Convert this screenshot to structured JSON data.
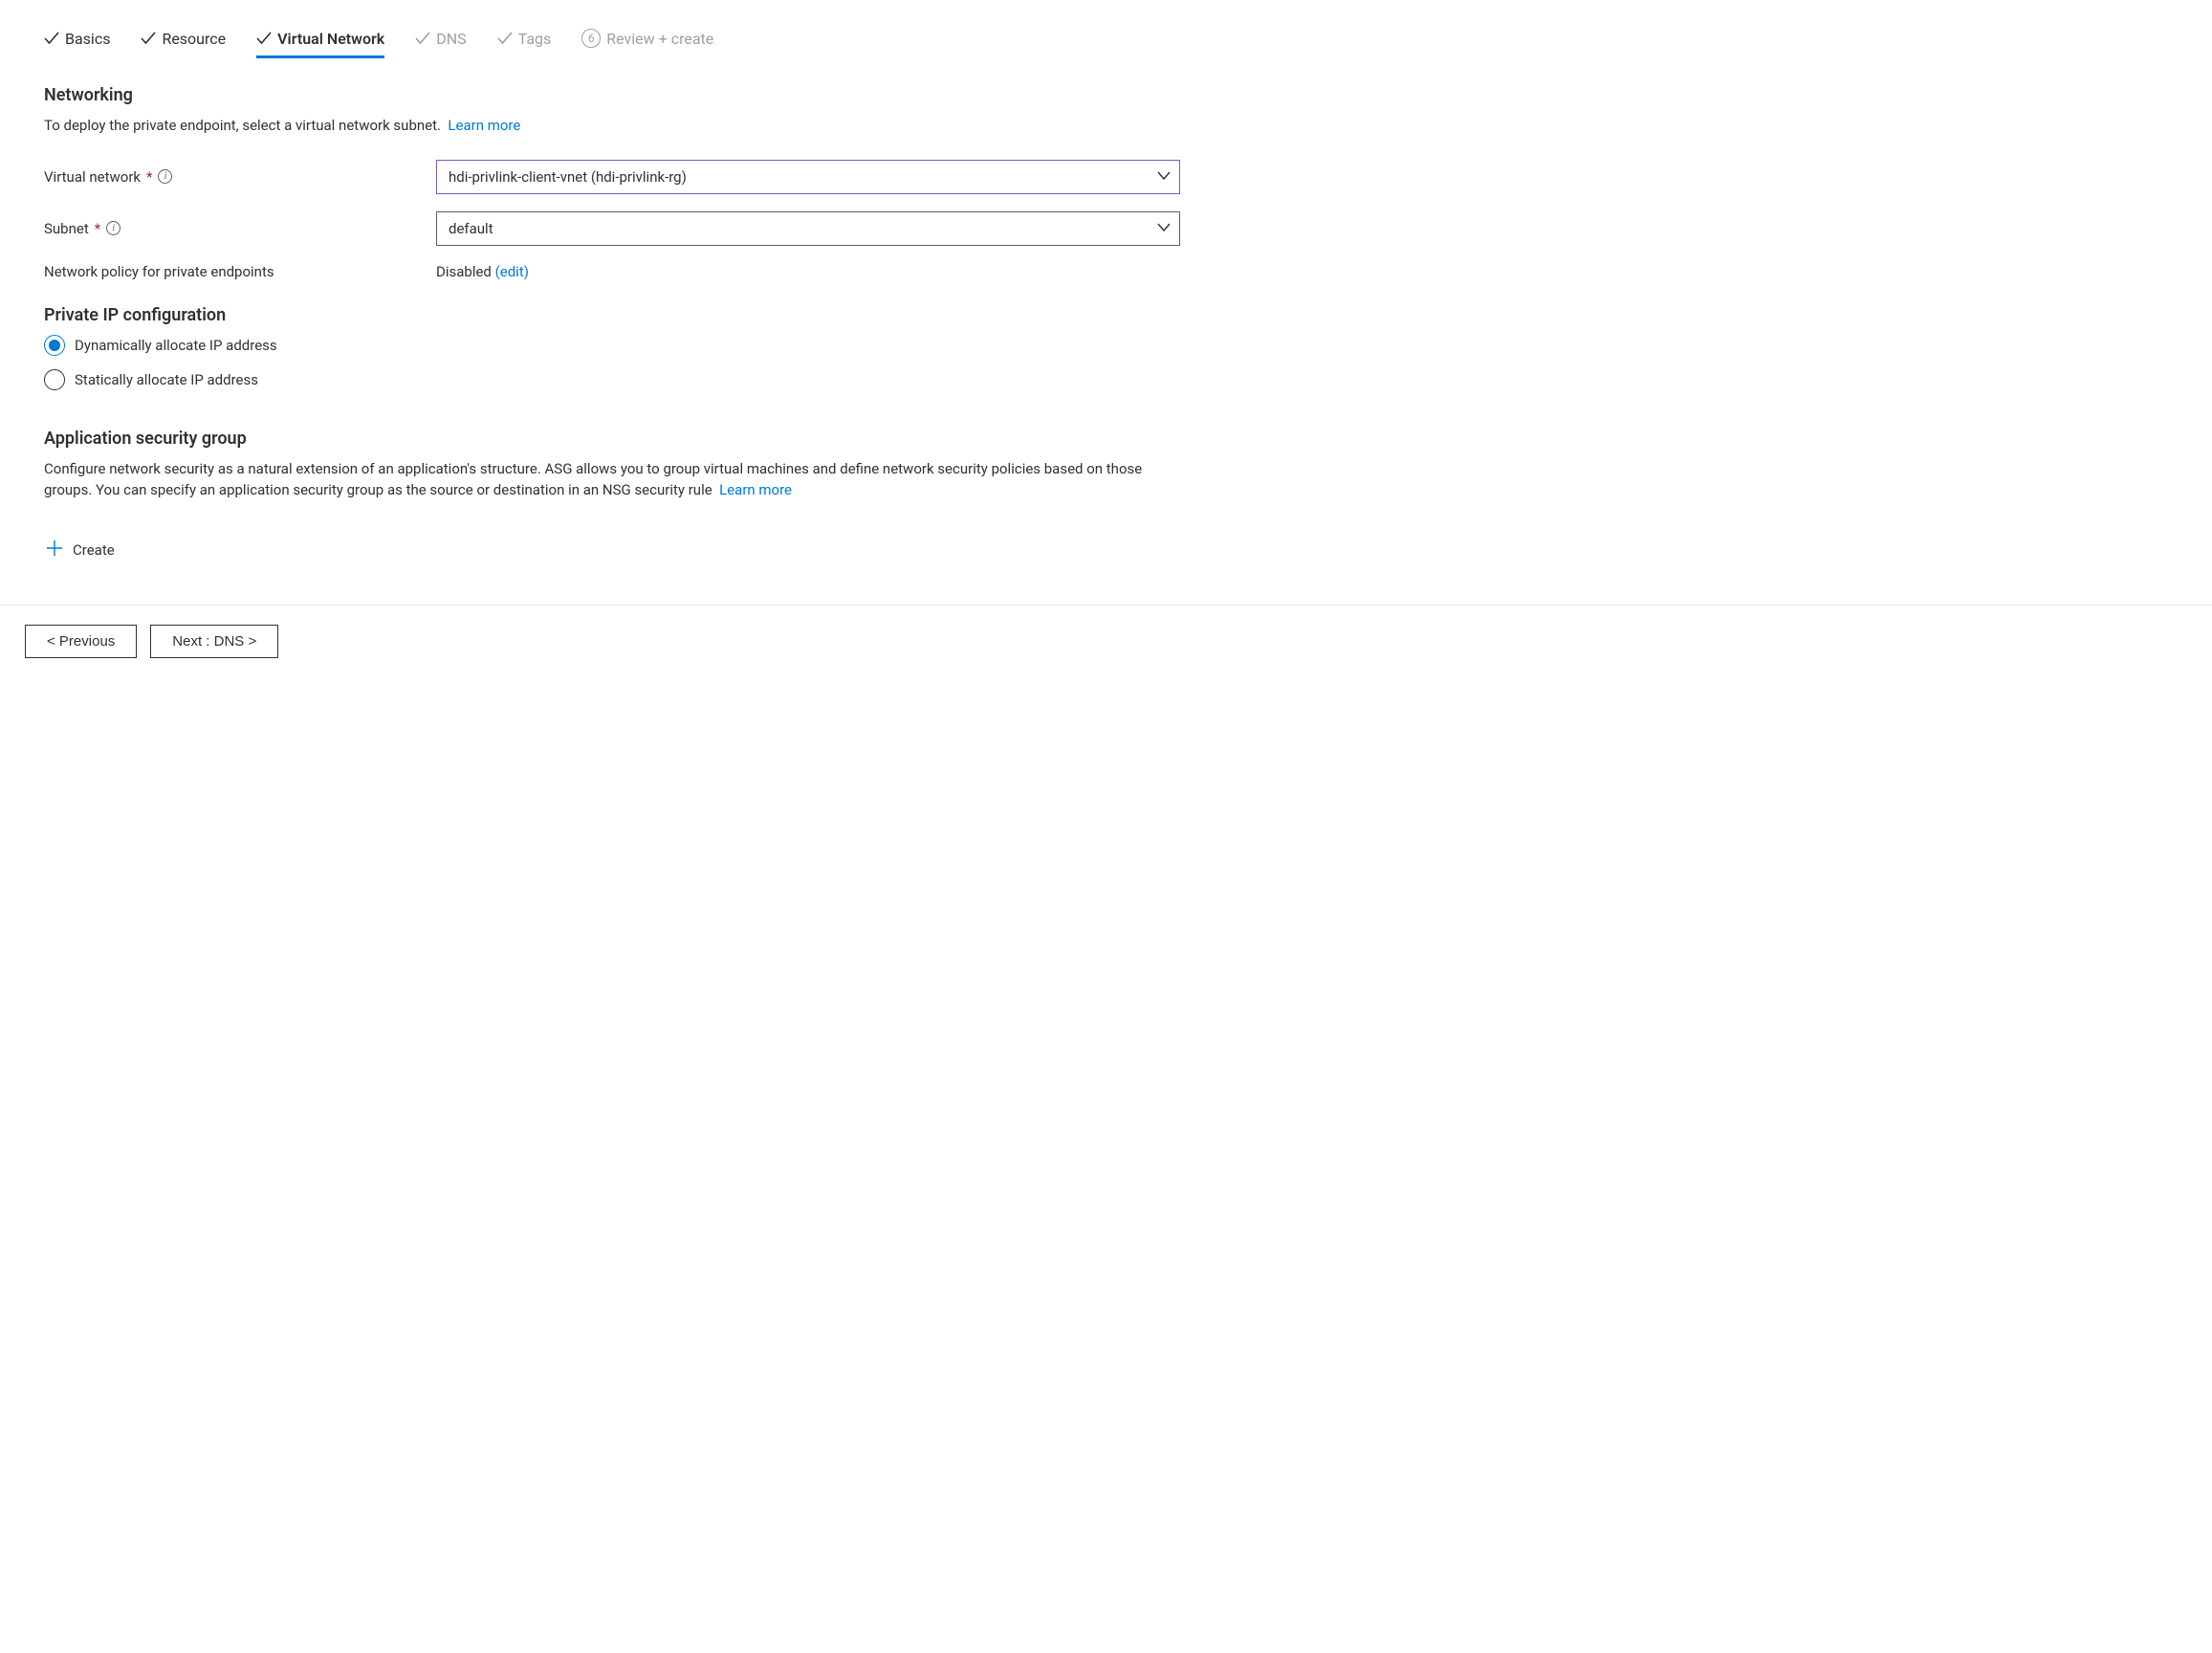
{
  "tabs": {
    "basics": "Basics",
    "resource": "Resource",
    "virtual_network": "Virtual Network",
    "dns": "DNS",
    "tags": "Tags",
    "review_step_num": "6",
    "review": "Review + create"
  },
  "networking": {
    "heading": "Networking",
    "desc": "To deploy the private endpoint, select a virtual network subnet.",
    "learn_more": "Learn more",
    "virtual_network_label": "Virtual network",
    "virtual_network_value": "hdi-privlink-client-vnet (hdi-privlink-rg)",
    "subnet_label": "Subnet",
    "subnet_value": "default",
    "policy_label": "Network policy for private endpoints",
    "policy_value": "Disabled",
    "policy_edit": "(edit)"
  },
  "private_ip": {
    "heading": "Private IP configuration",
    "option_dynamic": "Dynamically allocate IP address",
    "option_static": "Statically allocate IP address"
  },
  "asg": {
    "heading": "Application security group",
    "desc": "Configure network security as a natural extension of an application's structure. ASG allows you to group virtual machines and define network security policies based on those groups. You can specify an application security group as the source or destination in an NSG security rule",
    "learn_more": "Learn more",
    "create": "Create"
  },
  "footer": {
    "previous": "< Previous",
    "next": "Next : DNS >"
  }
}
